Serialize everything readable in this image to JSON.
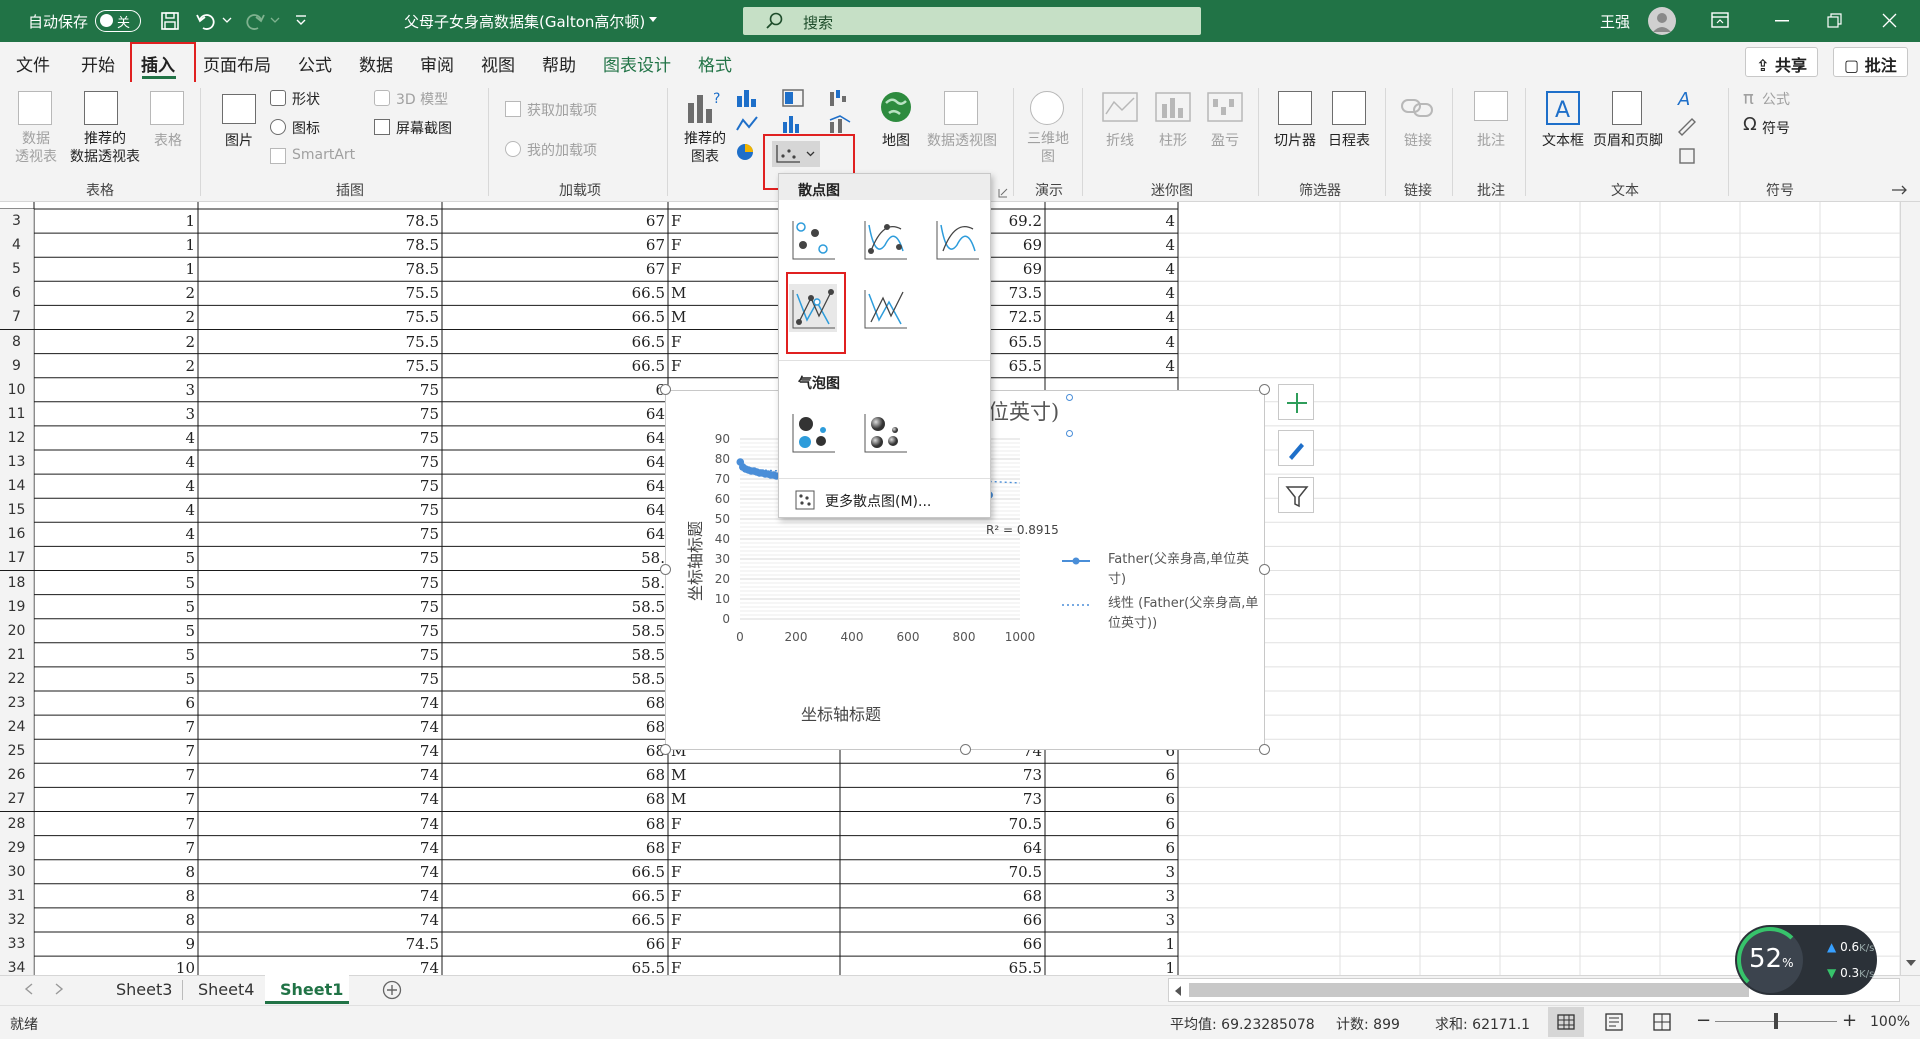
{
  "titlebar": {
    "autosave_label": "自动保存",
    "autosave_state": "关",
    "doc_title": "父母子女身高数据集(Galton高尔顿)",
    "search_placeholder": "搜索",
    "user_name": "王强"
  },
  "ribbon_tabs": [
    "文件",
    "开始",
    "插入",
    "页面布局",
    "公式",
    "数据",
    "审阅",
    "视图",
    "帮助",
    "图表设计",
    "格式"
  ],
  "active_tab": "插入",
  "share_label": "共享",
  "comment_label": "批注",
  "ribbon": {
    "groups": {
      "tables": "表格",
      "illustrations": "插图",
      "addins": "加载项",
      "tours": "演示",
      "sparklines": "迷你图",
      "filters": "筛选器",
      "links": "链接",
      "comments": "批注",
      "text": "文本",
      "symbols": "符号"
    },
    "tables": {
      "pivot": "数据\n透视表",
      "recommended_pivot": "推荐的\n数据透视表",
      "table": "表格"
    },
    "illustrations": {
      "pictures": "图片",
      "shapes": "形状",
      "icons": "图标",
      "models3d": "3D 模型",
      "smartart": "SmartArt",
      "screenshot": "屏幕截图"
    },
    "addins": {
      "get": "获取加载项",
      "my": "我的加载项"
    },
    "charts": {
      "recommended": "推荐的\n图表",
      "map": "地图",
      "pivot_chart": "数据透视图"
    },
    "tours": {
      "map3d": "三维地\n图"
    },
    "sparklines": {
      "line": "折线",
      "column": "柱形",
      "winloss": "盈亏"
    },
    "filters": {
      "slicer": "切片器",
      "timeline": "日程表"
    },
    "links": {
      "link": "链接"
    },
    "comments": {
      "comment": "批注"
    },
    "text": {
      "textbox": "文本框",
      "header_footer": "页眉和页脚"
    },
    "symbols": {
      "equation": "公式",
      "symbol": "符号"
    }
  },
  "dropdown": {
    "scatter_header": "散点图",
    "bubble_header": "气泡图",
    "more": "更多散点图(M)..."
  },
  "sheet": {
    "rows": [
      {
        "n": "3",
        "a": "1",
        "b": "78.5",
        "c": "67",
        "d": "F",
        "e": "69.2",
        "f": "4"
      },
      {
        "n": "4",
        "a": "1",
        "b": "78.5",
        "c": "67",
        "d": "F",
        "e": "69",
        "f": "4"
      },
      {
        "n": "5",
        "a": "1",
        "b": "78.5",
        "c": "67",
        "d": "F",
        "e": "69",
        "f": "4"
      },
      {
        "n": "6",
        "a": "2",
        "b": "75.5",
        "c": "66.5",
        "d": "M",
        "e": "73.5",
        "f": "4"
      },
      {
        "n": "7",
        "a": "2",
        "b": "75.5",
        "c": "66.5",
        "d": "M",
        "e": "72.5",
        "f": "4"
      },
      {
        "n": "8",
        "a": "2",
        "b": "75.5",
        "c": "66.5",
        "d": "F",
        "e": "65.5",
        "f": "4"
      },
      {
        "n": "9",
        "a": "2",
        "b": "75.5",
        "c": "66.5",
        "d": "F",
        "e": "65.5",
        "f": "4"
      },
      {
        "n": "10",
        "a": "3",
        "b": "75",
        "c": "6",
        "d": "",
        "e": "",
        "f": ""
      },
      {
        "n": "11",
        "a": "3",
        "b": "75",
        "c": "64",
        "d": "",
        "e": "",
        "f": ""
      },
      {
        "n": "12",
        "a": "4",
        "b": "75",
        "c": "64",
        "d": "",
        "e": "",
        "f": ""
      },
      {
        "n": "13",
        "a": "4",
        "b": "75",
        "c": "64",
        "d": "",
        "e": "",
        "f": ""
      },
      {
        "n": "14",
        "a": "4",
        "b": "75",
        "c": "64",
        "d": "",
        "e": "",
        "f": ""
      },
      {
        "n": "15",
        "a": "4",
        "b": "75",
        "c": "64",
        "d": "",
        "e": "",
        "f": ""
      },
      {
        "n": "16",
        "a": "4",
        "b": "75",
        "c": "64",
        "d": "",
        "e": "",
        "f": ""
      },
      {
        "n": "17",
        "a": "5",
        "b": "75",
        "c": "58.",
        "d": "",
        "e": "",
        "f": ""
      },
      {
        "n": "18",
        "a": "5",
        "b": "75",
        "c": "58.",
        "d": "",
        "e": "",
        "f": ""
      },
      {
        "n": "19",
        "a": "5",
        "b": "75",
        "c": "58.5",
        "d": "",
        "e": "",
        "f": ""
      },
      {
        "n": "20",
        "a": "5",
        "b": "75",
        "c": "58.5",
        "d": "",
        "e": "",
        "f": ""
      },
      {
        "n": "21",
        "a": "5",
        "b": "75",
        "c": "58.5",
        "d": "",
        "e": "",
        "f": ""
      },
      {
        "n": "22",
        "a": "5",
        "b": "75",
        "c": "58.5",
        "d": "",
        "e": "",
        "f": ""
      },
      {
        "n": "23",
        "a": "6",
        "b": "74",
        "c": "68",
        "d": "",
        "e": "",
        "f": ""
      },
      {
        "n": "24",
        "a": "7",
        "b": "74",
        "c": "68",
        "d": "",
        "e": "",
        "f": ""
      },
      {
        "n": "25",
        "a": "7",
        "b": "74",
        "c": "68",
        "d": "M",
        "e": "74",
        "f": "6"
      },
      {
        "n": "26",
        "a": "7",
        "b": "74",
        "c": "68",
        "d": "M",
        "e": "73",
        "f": "6"
      },
      {
        "n": "27",
        "a": "7",
        "b": "74",
        "c": "68",
        "d": "M",
        "e": "73",
        "f": "6"
      },
      {
        "n": "28",
        "a": "7",
        "b": "74",
        "c": "68",
        "d": "F",
        "e": "70.5",
        "f": "6"
      },
      {
        "n": "29",
        "a": "7",
        "b": "74",
        "c": "68",
        "d": "F",
        "e": "64",
        "f": "6"
      },
      {
        "n": "30",
        "a": "8",
        "b": "74",
        "c": "66.5",
        "d": "F",
        "e": "70.5",
        "f": "3"
      },
      {
        "n": "31",
        "a": "8",
        "b": "74",
        "c": "66.5",
        "d": "F",
        "e": "68",
        "f": "3"
      },
      {
        "n": "32",
        "a": "8",
        "b": "74",
        "c": "66.5",
        "d": "F",
        "e": "66",
        "f": "3"
      },
      {
        "n": "33",
        "a": "9",
        "b": "74.5",
        "c": "66",
        "d": "F",
        "e": "66",
        "f": "1"
      },
      {
        "n": "34",
        "a": "10",
        "b": "74",
        "c": "65.5",
        "d": "F",
        "e": "65.5",
        "f": "1"
      }
    ],
    "tabs": [
      "Sheet3",
      "Sheet4",
      "Sheet1"
    ],
    "active_tab": "Sheet1"
  },
  "chart_data": {
    "type": "scatter",
    "title_fragment": "位英寸)",
    "xlabel": "坐标轴标题",
    "ylabel": "坐标轴标题",
    "x_ticks": [
      "0",
      "200",
      "400",
      "600",
      "800",
      "1000"
    ],
    "y_ticks": [
      "0",
      "10",
      "20",
      "30",
      "40",
      "50",
      "60",
      "70",
      "80",
      "90"
    ],
    "xlim": [
      0,
      1000
    ],
    "ylim": [
      0,
      90
    ],
    "r_squared_label": "R² = 0.8915",
    "legend": [
      "Father(父亲身高,单位英寸)",
      "线性 (Father(父亲身高,单位英寸))"
    ],
    "series": [
      {
        "name": "Father(父亲身高,单位英寸)",
        "x": [
          1,
          10,
          20,
          30,
          40,
          50,
          60,
          70,
          80,
          90,
          100,
          110,
          120,
          130,
          140,
          150,
          160,
          170,
          180,
          190,
          200,
          210,
          220,
          230,
          880,
          890
        ],
        "y": [
          78.5,
          76,
          75,
          74.5,
          74,
          74,
          73.5,
          73,
          73,
          72.5,
          72.5,
          72,
          72,
          71.5,
          71.5,
          71,
          71,
          71,
          71,
          70.5,
          70.5,
          70.5,
          70,
          70,
          68,
          62
        ]
      }
    ],
    "series_color": "#4a8ed8"
  },
  "status": {
    "ready": "就绪",
    "average": "平均值: 69.23285078",
    "count": "计数: 899",
    "sum": "求和: 62171.1",
    "zoom": "100%"
  },
  "perf": {
    "percent": "52",
    "percent_unit": "%",
    "up": "0.6",
    "down": "0.3",
    "unit": "K/s"
  }
}
